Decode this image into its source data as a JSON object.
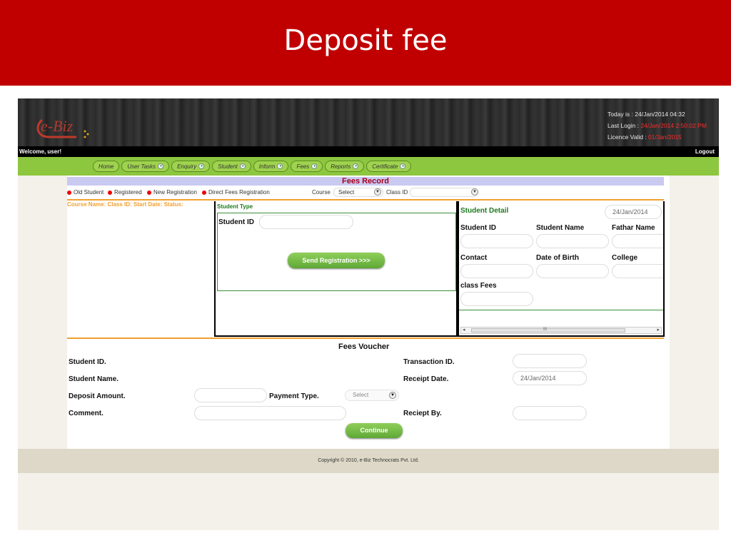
{
  "slide": {
    "title": "Deposit fee"
  },
  "header": {
    "logo_text": "e-Biz",
    "today_label": "Today is : ",
    "today_value": "24/Jan/2014 04:32",
    "last_login_label": "Last Login : ",
    "last_login_value": "24/Jan/2014 2:50:02 PM",
    "licence_label": "Licence Valid : ",
    "licence_value": "01/Jan/2015",
    "welcome": "Welcome,  user!",
    "logout": "Logout"
  },
  "menu": [
    {
      "label": "Home",
      "has_dropdown": false
    },
    {
      "label": "User Tasks",
      "has_dropdown": true
    },
    {
      "label": "Enquiry",
      "has_dropdown": true
    },
    {
      "label": "Student",
      "has_dropdown": true
    },
    {
      "label": "Inform",
      "has_dropdown": true
    },
    {
      "label": "Fees",
      "has_dropdown": true
    },
    {
      "label": "Reports",
      "has_dropdown": true
    },
    {
      "label": "Certificate",
      "has_dropdown": true
    }
  ],
  "fees_record": {
    "title": "Fees Record",
    "options": [
      "Old Student",
      "Registered",
      "New Registration",
      "Direct Fees Registration"
    ],
    "course_label": "Course",
    "course_value": "Select",
    "class_id_label": "Class ID",
    "class_id_value": "",
    "course_info": "Course Name: Class ID: Start Date: Status:"
  },
  "student_type": {
    "title": "Student Type",
    "student_id_label": "Student ID",
    "student_id_value": "",
    "send_button": "Send Registration >>>"
  },
  "student_detail": {
    "title": "Student Detail",
    "date": "24/Jan/2014",
    "fields": [
      "Student ID",
      "Student Name",
      "Fathar Name",
      "Contact",
      "Date of Birth",
      "College",
      "class  Fees"
    ],
    "scroll_grip": "III"
  },
  "voucher": {
    "title": "Fees Voucher",
    "student_id_label": "Student ID.",
    "student_name_label": "Student Name.",
    "deposit_amount_label": "Deposit Amount.",
    "deposit_amount_value": "",
    "payment_type_label": "Payment Type.",
    "payment_type_value": "Select",
    "comment_label": "Comment.",
    "comment_value": "",
    "transaction_id_label": "Transaction ID.",
    "transaction_id_value": "",
    "receipt_date_label": "Receipt Date.",
    "receipt_date_value": "24/Jan/2014",
    "receipt_by_label": "Reciept By.",
    "receipt_by_value": "",
    "continue_button": "Continue"
  },
  "footer": {
    "copyright": "Copyright © 2010, e-Biz Technocrats Pvt. Ltd."
  },
  "colors": {
    "slide_red": "#c00000",
    "menu_green": "#8dc63f",
    "accent_orange": "#f0a030",
    "title_maroon": "#a8001e"
  }
}
